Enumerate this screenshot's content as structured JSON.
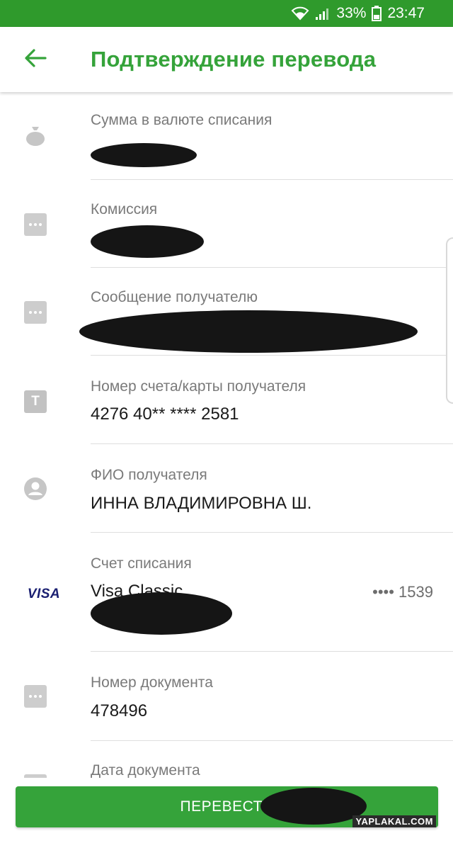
{
  "status_bar": {
    "battery": "33%",
    "time": "23:47"
  },
  "app_bar": {
    "title": "Подтверждение перевода",
    "back_icon": "arrow-left-icon"
  },
  "fields": {
    "amount": {
      "label": "Сумма в валюте списания",
      "icon": "money-bag-icon"
    },
    "commission": {
      "label": "Комиссия",
      "icon": "dots-icon"
    },
    "message": {
      "label": "Сообщение получателю",
      "icon": "dots-icon"
    },
    "card_number": {
      "label": "Номер счета/карты получателя",
      "value": "4276 40** **** 2581",
      "icon": "t-icon"
    },
    "recipient_name": {
      "label": "ФИО получателя",
      "value": "ИННА ВЛАДИМИРОВНА Ш.",
      "icon": "person-icon"
    },
    "debit_account": {
      "label": "Счет списания",
      "value": "Visa Classic",
      "suffix": "•••• 1539",
      "icon_text": "VISA"
    },
    "document_number": {
      "label": "Номер документа",
      "value": "478496",
      "icon": "dots-icon"
    },
    "document_date": {
      "label": "Дата документа",
      "icon": "dots-icon"
    }
  },
  "actions": {
    "submit_label": "ПЕРЕВЕСТИ"
  },
  "watermark": "YAPLAKAL.COM",
  "colors": {
    "status_bar": "#2f9a2c",
    "accent": "#35a33a",
    "visa": "#1a1f71"
  }
}
